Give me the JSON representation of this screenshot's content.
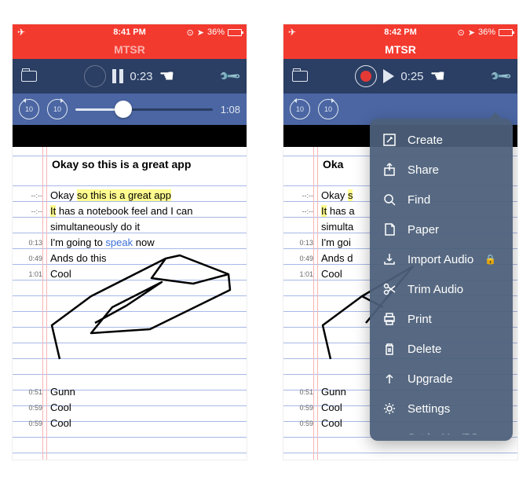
{
  "screen1": {
    "status": {
      "time": "8:41 PM",
      "battery": "36%"
    },
    "title": "MTSR",
    "toolbar": {
      "elapsed": "0:23"
    },
    "scrub": {
      "skipBack": "10",
      "skipFwd": "10",
      "duration": "1:08",
      "progress_pct": 35
    },
    "heading": "Okay so this is a great app",
    "lines": [
      {
        "t": "--:--",
        "html": "Okay <span class='hl'>so this is a great app</span>"
      },
      {
        "t": "--:--",
        "html": "<span class='hl'>It</span> has a notebook feel and I can"
      },
      {
        "t": "",
        "html": "simultaneously do it"
      },
      {
        "t": "0:13",
        "html": "I'm going to <span class='link'>speak</span> now"
      },
      {
        "t": "0:49",
        "html": "Ands do this"
      },
      {
        "t": "1:01",
        "html": "Cool"
      }
    ],
    "footer": [
      {
        "t": "0:51",
        "text": "Gunn"
      },
      {
        "t": "0:59",
        "text": "Cool"
      },
      {
        "t": "0:59",
        "text": "Cool"
      }
    ]
  },
  "screen2": {
    "status": {
      "time": "8:42 PM",
      "battery": "36%"
    },
    "title": "MTSR",
    "toolbar": {
      "elapsed": "0:25"
    },
    "scrub": {
      "skipBack": "10",
      "skipFwd": "10"
    },
    "heading": "Oka",
    "lines": [
      {
        "t": "--:--",
        "html": "Okay <span class='hl'>s</span>"
      },
      {
        "t": "--:--",
        "html": "<span class='hl'>It</span> has a"
      },
      {
        "t": "",
        "html": "simulta"
      },
      {
        "t": "0:13",
        "html": "I'm goi"
      },
      {
        "t": "0:49",
        "html": "Ands d"
      },
      {
        "t": "1:01",
        "html": "Cool"
      }
    ],
    "footer": [
      {
        "t": "0:51",
        "text": "Gunn"
      },
      {
        "t": "0:59",
        "text": "Cool"
      },
      {
        "t": "0:59",
        "text": "Cool"
      }
    ],
    "menu": {
      "items": [
        {
          "icon": "create",
          "label": "Create"
        },
        {
          "icon": "share",
          "label": "Share"
        },
        {
          "icon": "find",
          "label": "Find"
        },
        {
          "icon": "paper",
          "label": "Paper"
        },
        {
          "icon": "import",
          "label": "Import Audio",
          "locked": true
        },
        {
          "icon": "trim",
          "label": "Trim Audio"
        },
        {
          "icon": "print",
          "label": "Print"
        },
        {
          "icon": "delete",
          "label": "Delete"
        },
        {
          "icon": "upgrade",
          "label": "Upgrade"
        },
        {
          "icon": "settings",
          "label": "Settings"
        }
      ],
      "cutoff": "Get for Mac/PC"
    }
  }
}
